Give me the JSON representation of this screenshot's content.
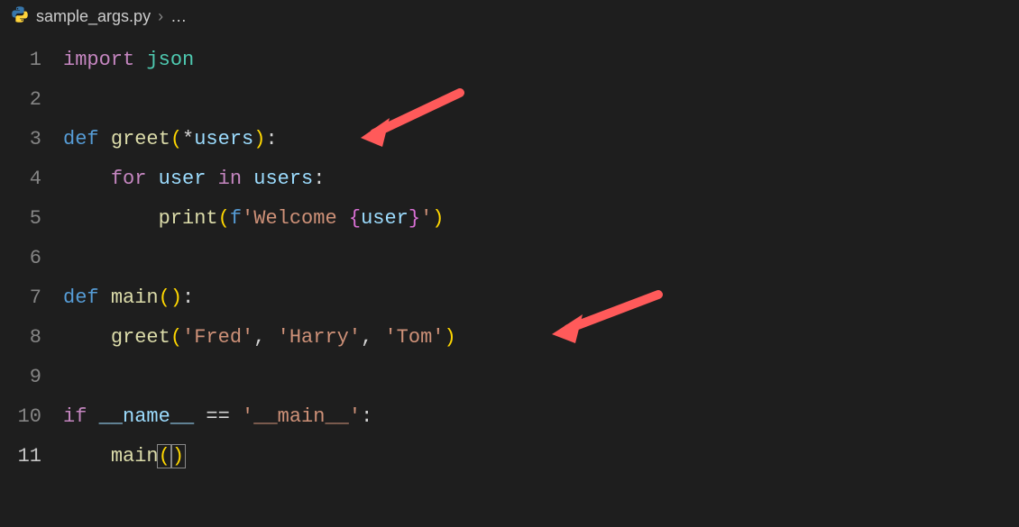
{
  "breadcrumb": {
    "filename": "sample_args.py",
    "separator": "›",
    "rest": "…"
  },
  "lines": [
    {
      "n": 1,
      "active": false
    },
    {
      "n": 2,
      "active": false
    },
    {
      "n": 3,
      "active": false
    },
    {
      "n": 4,
      "active": false
    },
    {
      "n": 5,
      "active": false
    },
    {
      "n": 6,
      "active": false
    },
    {
      "n": 7,
      "active": false
    },
    {
      "n": 8,
      "active": false
    },
    {
      "n": 9,
      "active": false
    },
    {
      "n": 10,
      "active": false
    },
    {
      "n": 11,
      "active": true
    }
  ],
  "code": {
    "l1": {
      "kw": "import",
      "mod": "json"
    },
    "l3": {
      "kw": "def",
      "fn": "greet",
      "lp": "(",
      "star": "*",
      "arg": "users",
      "rp": ")",
      "colon": ":"
    },
    "l4": {
      "kw": "for",
      "v1": "user",
      "in": "in",
      "v2": "users",
      "colon": ":"
    },
    "l5": {
      "fn": "print",
      "lp": "(",
      "f": "f",
      "q1": "'",
      "s1": "Welcome ",
      "lb": "{",
      "v": "user",
      "rb": "}",
      "q2": "'",
      "rp": ")"
    },
    "l7": {
      "kw": "def",
      "fn": "main",
      "lp": "(",
      "rp": ")",
      "colon": ":"
    },
    "l8": {
      "fn": "greet",
      "lp": "(",
      "a1": "'Fred'",
      "c1": ", ",
      "a2": "'Harry'",
      "c2": ", ",
      "a3": "'Tom'",
      "rp": ")"
    },
    "l10": {
      "kw": "if",
      "name": "__name__",
      "eq": " == ",
      "main": "'__main__'",
      "colon": ":"
    },
    "l11": {
      "fn": "main",
      "lp": "(",
      "rp": ")"
    }
  },
  "annotations": {
    "arrow1": {
      "target": "def greet line"
    },
    "arrow2": {
      "target": "greet call line"
    }
  }
}
